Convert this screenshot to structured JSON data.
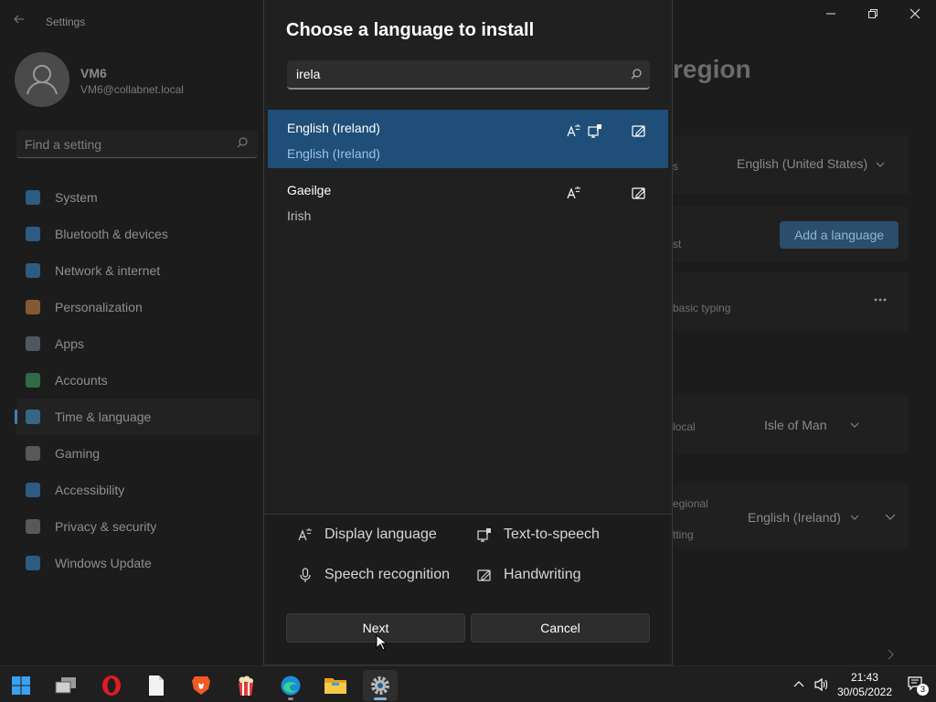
{
  "settings": {
    "title": "Settings",
    "profile": {
      "name": "VM6",
      "email": "VM6@collabnet.local"
    },
    "search_placeholder": "Find a setting",
    "nav": [
      {
        "label": "System",
        "icon": "monitor-icon",
        "color": "#3a8fd9"
      },
      {
        "label": "Bluetooth & devices",
        "icon": "bluetooth-icon",
        "color": "#3a8fd9"
      },
      {
        "label": "Network & internet",
        "icon": "wifi-icon",
        "color": "#3a8fd9"
      },
      {
        "label": "Personalization",
        "icon": "brush-icon",
        "color": "#d98c4a"
      },
      {
        "label": "Apps",
        "icon": "apps-icon",
        "color": "#7a8a9a"
      },
      {
        "label": "Accounts",
        "icon": "person-icon",
        "color": "#3fae6a"
      },
      {
        "label": "Time & language",
        "icon": "globe-clock-icon",
        "color": "#4a9fd9",
        "active": true
      },
      {
        "label": "Gaming",
        "icon": "gamepad-icon",
        "color": "#8a8a8a"
      },
      {
        "label": "Accessibility",
        "icon": "accessibility-icon",
        "color": "#3a8fd9"
      },
      {
        "label": "Privacy & security",
        "icon": "shield-icon",
        "color": "#8a8a8a"
      },
      {
        "label": "Windows Update",
        "icon": "update-icon",
        "color": "#3a8fd9"
      }
    ],
    "page_title": "region",
    "display_language_value": "English (United States)",
    "add_language_label": "Add a language",
    "basic_typing_text": "basic typing",
    "country_text": "local",
    "country_value": "Isle of Man",
    "regional_text": "egional",
    "formatting_text": "tting",
    "regional_format_value": "English (Ireland)",
    "snippet_s": "s",
    "snippet_st": "st"
  },
  "dialog": {
    "title": "Choose a language to install",
    "search_value": "irela",
    "languages": [
      {
        "name": "English (Ireland)",
        "subtitle": "English (Ireland)",
        "selected": true,
        "features": [
          "display-language",
          "text-to-speech",
          "handwriting"
        ]
      },
      {
        "name": "Gaeilge",
        "subtitle": "Irish",
        "selected": false,
        "features": [
          "display-language",
          "handwriting"
        ]
      }
    ],
    "legend": {
      "display_language": "Display language",
      "text_to_speech": "Text-to-speech",
      "speech_recognition": "Speech recognition",
      "handwriting": "Handwriting"
    },
    "next_label": "Next",
    "cancel_label": "Cancel"
  },
  "taskbar": {
    "apps": [
      "start-icon",
      "task-view-icon",
      "opera-icon",
      "notepad-icon",
      "brave-icon",
      "popcorn-icon",
      "edge-icon",
      "file-explorer-icon",
      "settings-icon"
    ],
    "time": "21:43",
    "date": "30/05/2022",
    "notification_count": "3"
  },
  "colors": {
    "accent": "#1f4e78",
    "background": "#202020"
  }
}
